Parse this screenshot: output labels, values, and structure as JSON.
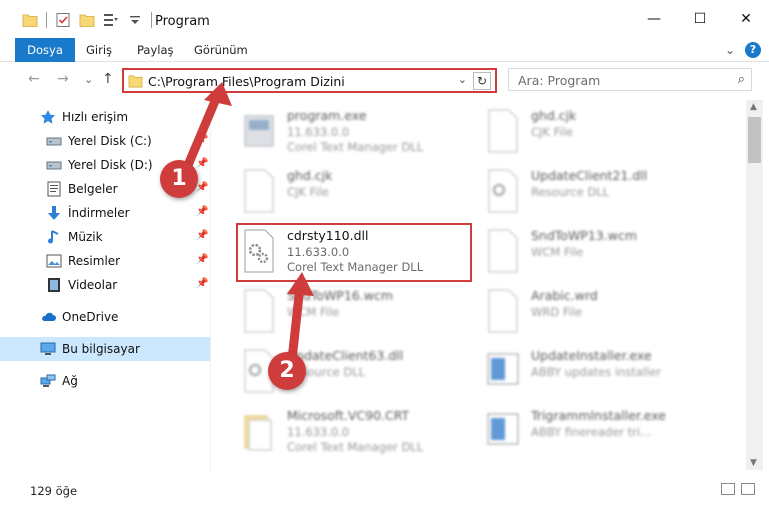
{
  "window": {
    "title": "Program",
    "minimize": "—",
    "maximize": "☐",
    "close": "✕"
  },
  "ribbon": {
    "tabs": [
      "Dosya",
      "Giriş",
      "Paylaş",
      "Görünüm"
    ],
    "expand": "⌄",
    "help": "?"
  },
  "nav": {
    "back": "←",
    "forward": "→",
    "recent": "⌄",
    "up": "↑"
  },
  "address": {
    "path": "C:\\Program Files\\Program Dizini",
    "dropdown": "⌄",
    "refresh": "↻"
  },
  "search": {
    "placeholder": "Ara: Program",
    "icon": "⌕"
  },
  "sidebar": {
    "items": [
      {
        "label": "Hızlı erişim",
        "icon": "star-icon"
      },
      {
        "label": "Yerel Disk (C:)",
        "icon": "drive-icon",
        "pinned": true
      },
      {
        "label": "Yerel Disk (D:)",
        "icon": "drive-icon",
        "pinned": true
      },
      {
        "label": "Belgeler",
        "icon": "documents-icon",
        "pinned": true
      },
      {
        "label": "İndirmeler",
        "icon": "download-icon",
        "pinned": true
      },
      {
        "label": "Müzik",
        "icon": "music-icon",
        "pinned": true
      },
      {
        "label": "Resimler",
        "icon": "pictures-icon",
        "pinned": true
      },
      {
        "label": "Videolar",
        "icon": "video-icon",
        "pinned": true
      },
      {
        "label": "OneDrive",
        "icon": "cloud-icon"
      },
      {
        "label": "Bu bilgisayar",
        "icon": "computer-icon",
        "selected": true
      },
      {
        "label": "Ağ",
        "icon": "network-icon"
      }
    ]
  },
  "files": {
    "left": [
      {
        "name": "program.exe",
        "line2": "11.633.0.0",
        "line3": "Corel Text Manager DLL",
        "blurred": true
      },
      {
        "name": "ghd.cjk",
        "line2": "CJK File",
        "line3": "",
        "blurred": true
      },
      {
        "name": "cdrsty110.dll",
        "line2": "11.633.0.0",
        "line3": "Corel Text Manager DLL",
        "blurred": false
      },
      {
        "name": "SndToWP16.wcm",
        "line2": "WCM File",
        "line3": "",
        "blurred": true
      },
      {
        "name": "UpdateClient63.dll",
        "line2": "Resource DLL",
        "line3": "",
        "blurred": true
      },
      {
        "name": "Microsoft.VC90.CRT",
        "line2": "11.633.0.0",
        "line3": "Corel Text Manager DLL",
        "blurred": true
      }
    ],
    "right": [
      {
        "name": "ghd.cjk",
        "line2": "CJK File",
        "line3": "",
        "blurred": true
      },
      {
        "name": "UpdateClient21.dll",
        "line2": "Resource DLL",
        "line3": "",
        "blurred": true
      },
      {
        "name": "SndToWP13.wcm",
        "line2": "WCM File",
        "line3": "",
        "blurred": true
      },
      {
        "name": "Arabic.wrd",
        "line2": "WRD File",
        "line3": "",
        "blurred": true
      },
      {
        "name": "UpdateInstaller.exe",
        "line2": "ABBY updates installer",
        "line3": "",
        "blurred": true
      },
      {
        "name": "TrigrammInstaller.exe",
        "line2": "ABBY finereader tri...",
        "line3": "",
        "blurred": true
      }
    ]
  },
  "status": {
    "count": "129 öğe"
  },
  "annotations": {
    "step1": "1",
    "step2": "2",
    "color": "#cf3c3c"
  },
  "colors": {
    "accent": "#1979ca",
    "selection": "#cce8ff",
    "highlight": "#d03b3b"
  }
}
